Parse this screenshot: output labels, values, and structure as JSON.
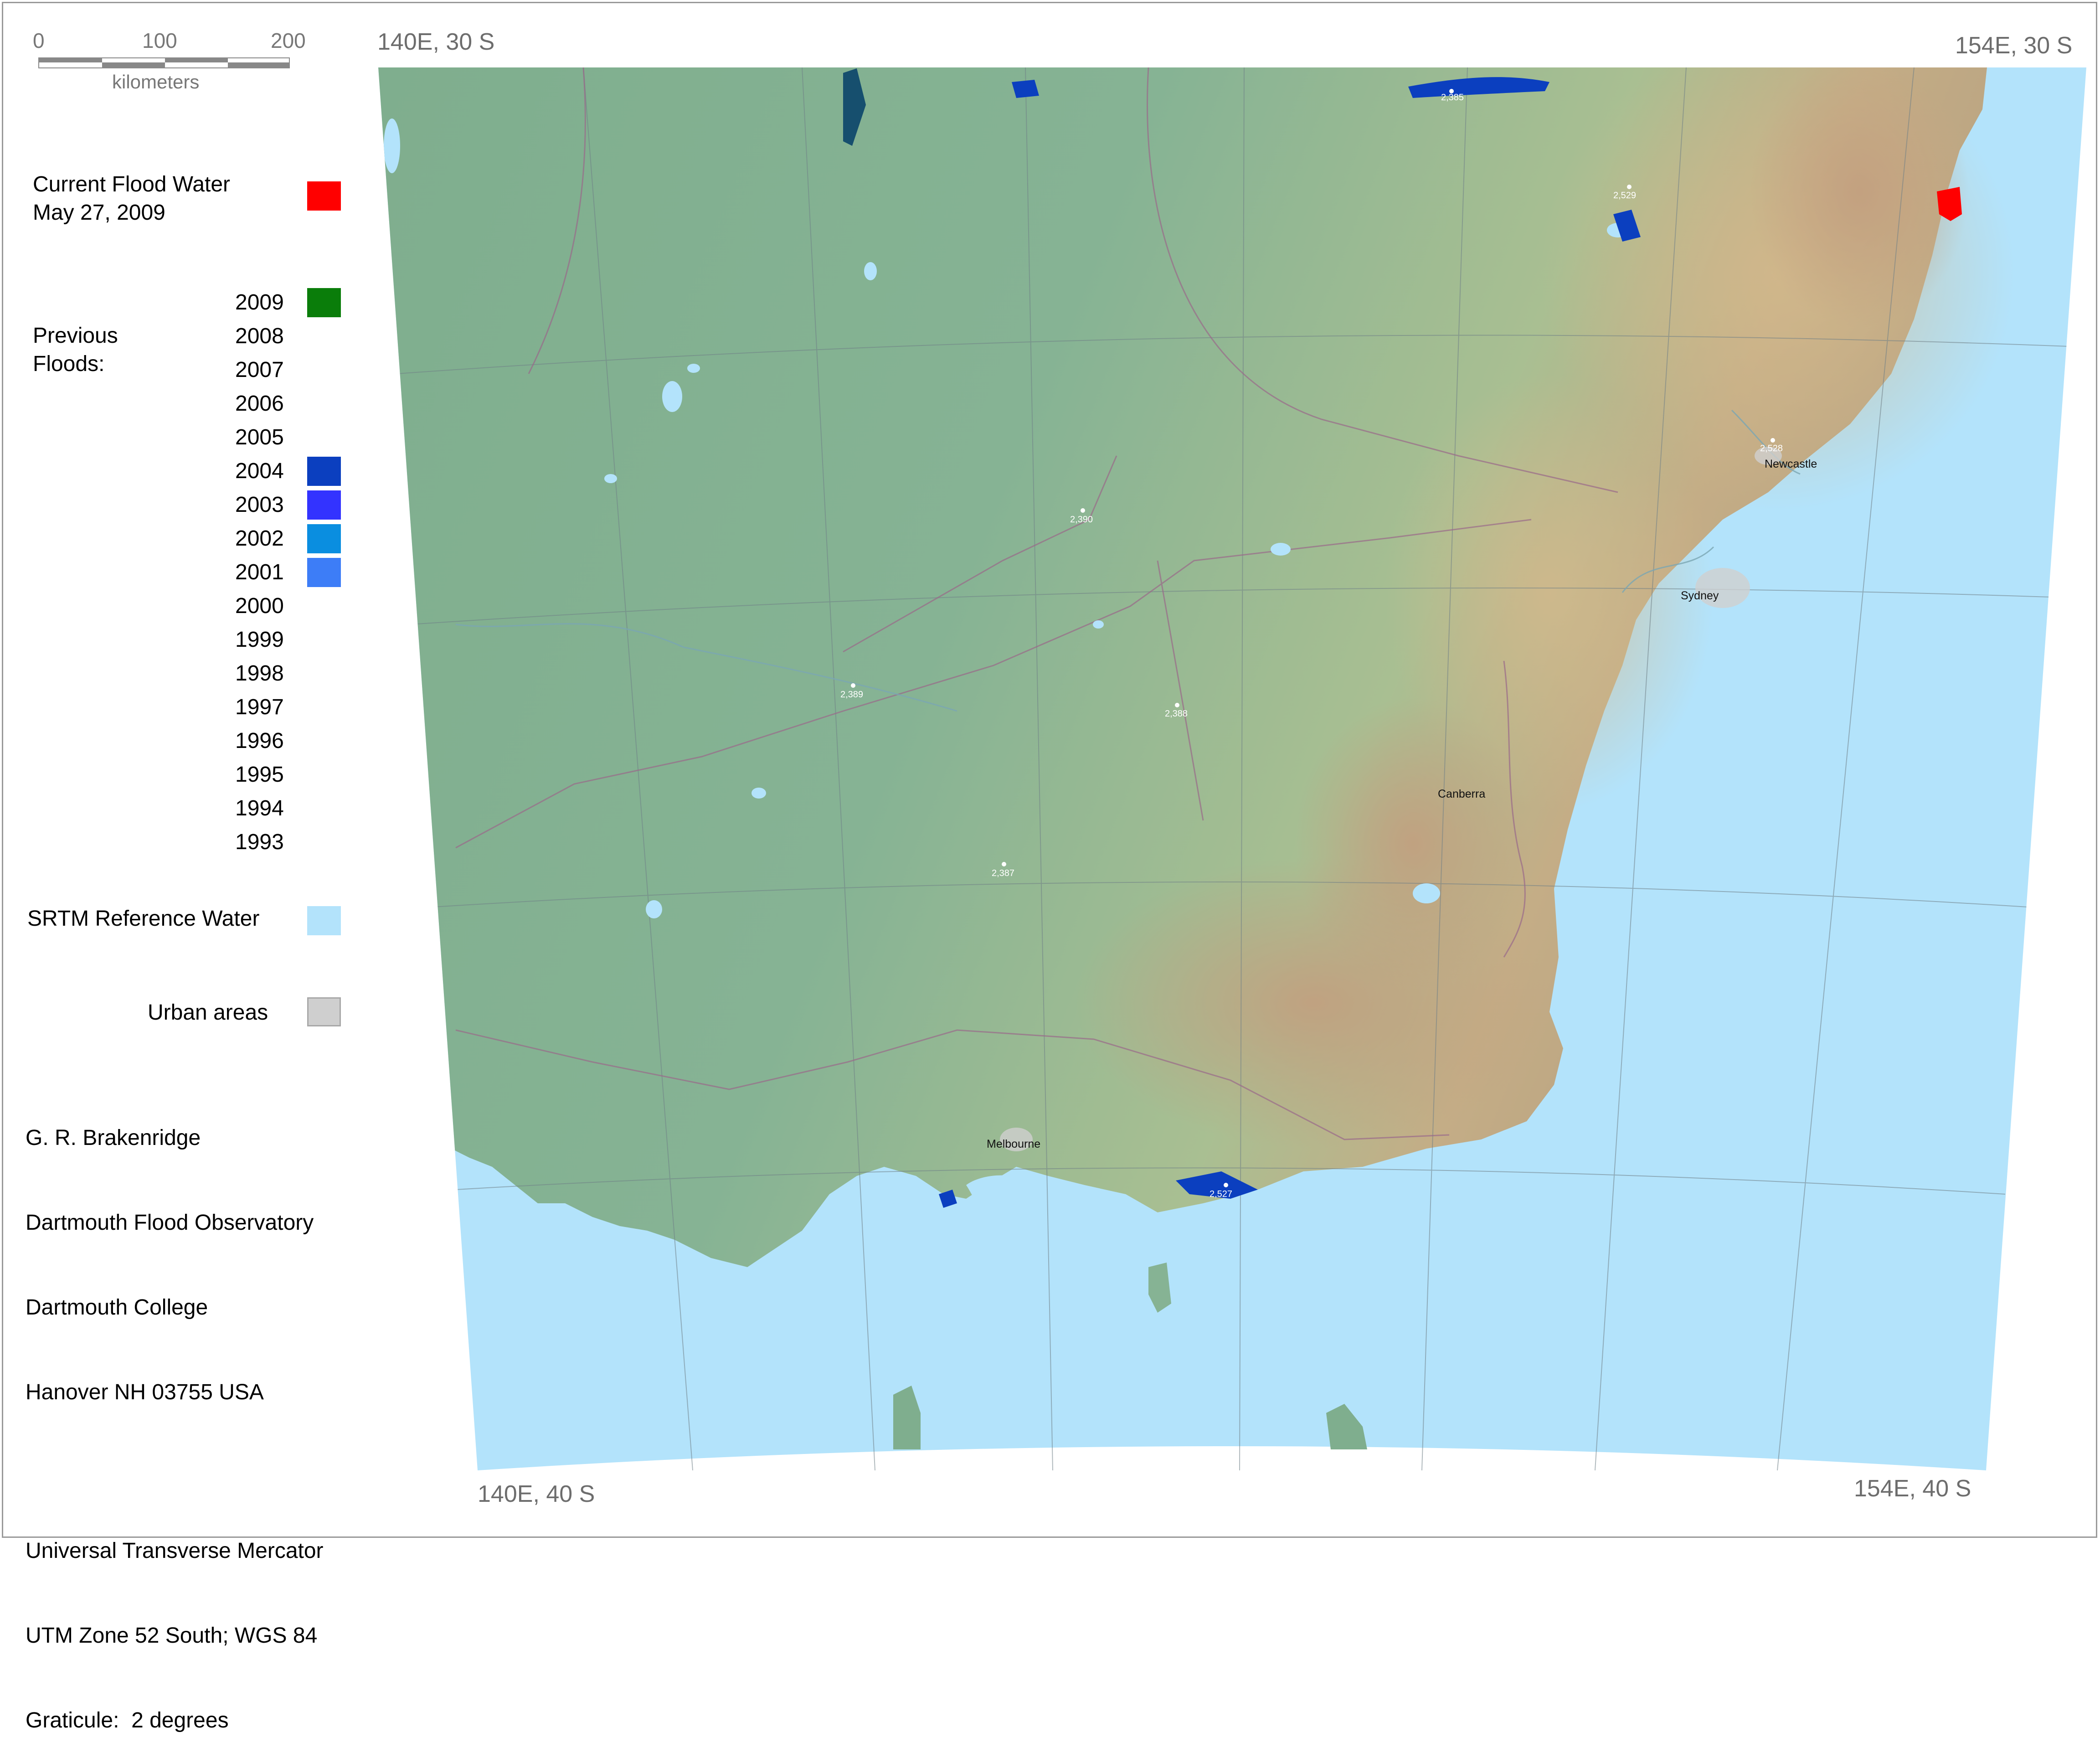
{
  "scale_bar": {
    "ticks": [
      "0",
      "100",
      "200"
    ],
    "unit": "kilometers"
  },
  "legend": {
    "current_flood": {
      "label_line1": "Current Flood Water",
      "label_line2": "May 27, 2009",
      "color": "#ff0000"
    },
    "previous_floods_label_line1": "Previous",
    "previous_floods_label_line2": "Floods:",
    "years": [
      {
        "year": "2009",
        "color": "#0a7d0a"
      },
      {
        "year": "2008",
        "color": null
      },
      {
        "year": "2007",
        "color": null
      },
      {
        "year": "2006",
        "color": null
      },
      {
        "year": "2005",
        "color": null
      },
      {
        "year": "2004",
        "color": "#0b3fbf"
      },
      {
        "year": "2003",
        "color": "#3333ff"
      },
      {
        "year": "2002",
        "color": "#0a8ee0"
      },
      {
        "year": "2001",
        "color": "#3d7df7"
      },
      {
        "year": "2000",
        "color": null
      },
      {
        "year": "1999",
        "color": null
      },
      {
        "year": "1998",
        "color": null
      },
      {
        "year": "1997",
        "color": null
      },
      {
        "year": "1996",
        "color": null
      },
      {
        "year": "1995",
        "color": null
      },
      {
        "year": "1994",
        "color": null
      },
      {
        "year": "1993",
        "color": null
      }
    ],
    "srtm": {
      "label": "SRTM Reference Water",
      "color": "#b3e3fb"
    },
    "urban": {
      "label": "Urban areas",
      "color": "#cfcfcf"
    }
  },
  "credits": {
    "author": "G. R. Brakenridge",
    "org1": "Dartmouth Flood Observatory",
    "org2": "Dartmouth College",
    "address": "Hanover NH 03755 USA",
    "projection": "Universal Transverse Mercator",
    "zone": "UTM Zone 52 South; WGS 84",
    "graticule": "Graticule:  2 degrees"
  },
  "corners": {
    "top_left": "140E, 30 S",
    "top_right": "154E, 30 S",
    "bottom_left": "140E, 40 S",
    "bottom_right": "154E, 40 S"
  },
  "cities": {
    "newcastle": "Newcastle",
    "sydney": "Sydney",
    "canberra": "Canberra",
    "melbourne": "Melbourne"
  },
  "gauges": {
    "g2385": "2,385",
    "g2529": "2,529",
    "g2528": "2,528",
    "g2390": "2,390",
    "g2389": "2,389",
    "g2388": "2,388",
    "g2387": "2,387",
    "g2527": "2,527"
  },
  "colors": {
    "ocean": "#b3e3fb",
    "land_low": "#7fb096",
    "land_high": "#d2b48c",
    "current_flood": "#ff0000",
    "flood_2004": "#0b3fbf"
  }
}
